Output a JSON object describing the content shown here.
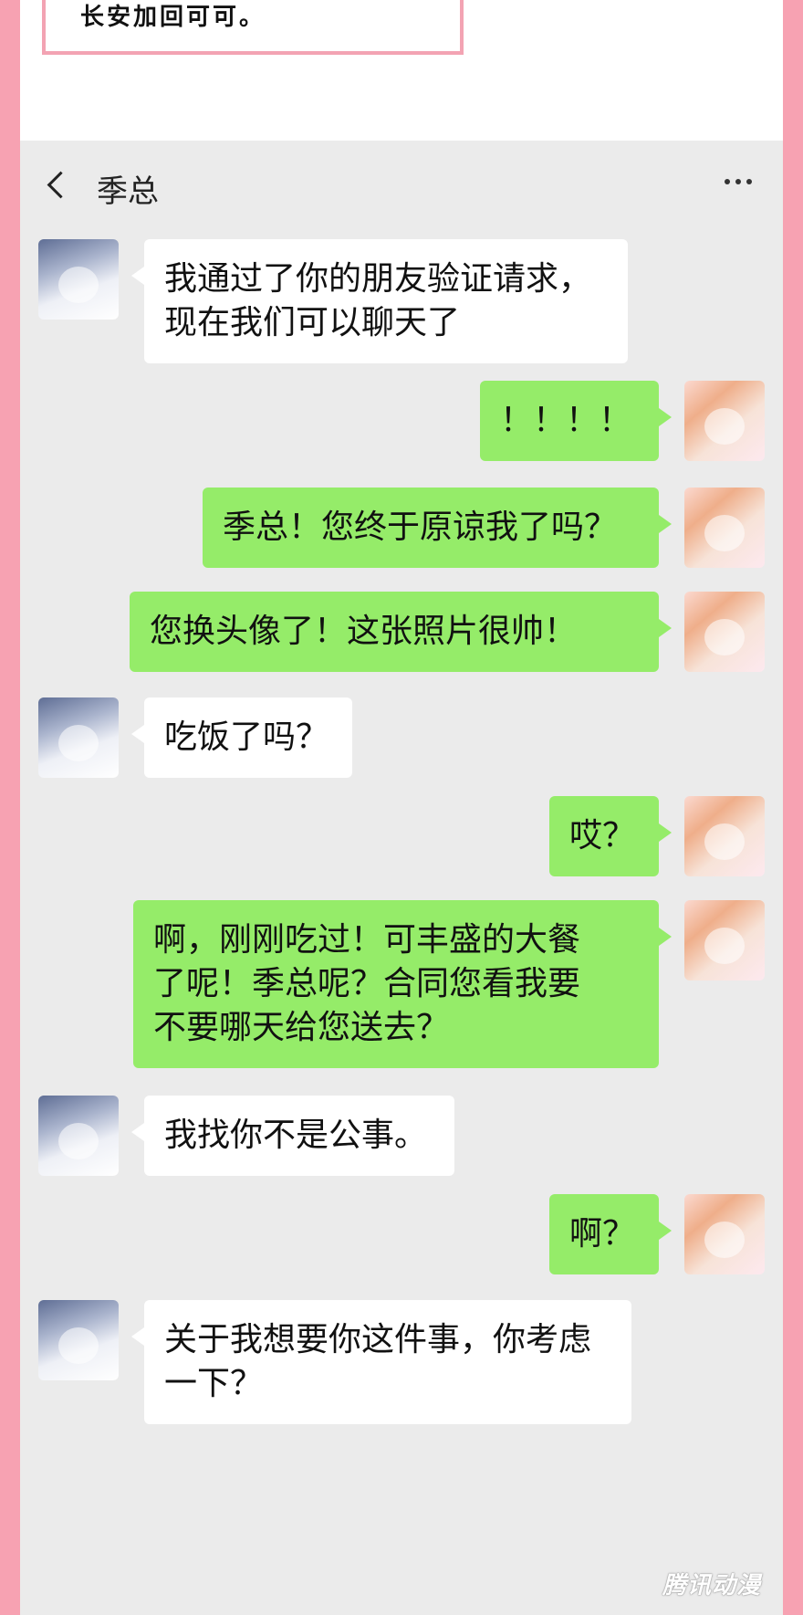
{
  "top_note": "长安加回可可。",
  "header": {
    "title": "季总"
  },
  "messages": [
    {
      "from": "in",
      "text": "我通过了你的朋友验证请求，\n现在我们可以聊天了"
    },
    {
      "from": "out",
      "text": "！！！！"
    },
    {
      "from": "out",
      "text": "季总！您终于原谅我了吗？"
    },
    {
      "from": "out",
      "text": "您换头像了！这张照片很帅！"
    },
    {
      "from": "in",
      "text": "吃饭了吗？"
    },
    {
      "from": "out",
      "text": "哎？"
    },
    {
      "from": "out",
      "text": "啊，刚刚吃过！可丰盛的大餐\n了呢！季总呢？合同您看我要\n不要哪天给您送去？"
    },
    {
      "from": "in",
      "text": "我找你不是公事。"
    },
    {
      "from": "out",
      "text": "啊？"
    },
    {
      "from": "in",
      "text": "关于我想要你这件事，你考虑\n一下？"
    }
  ],
  "watermark": "腾讯动漫",
  "colors": {
    "sent_bubble": "#95ec69",
    "received_bubble": "#ffffff",
    "chat_bg": "#ebebeb",
    "frame": "#f7a2b2"
  }
}
